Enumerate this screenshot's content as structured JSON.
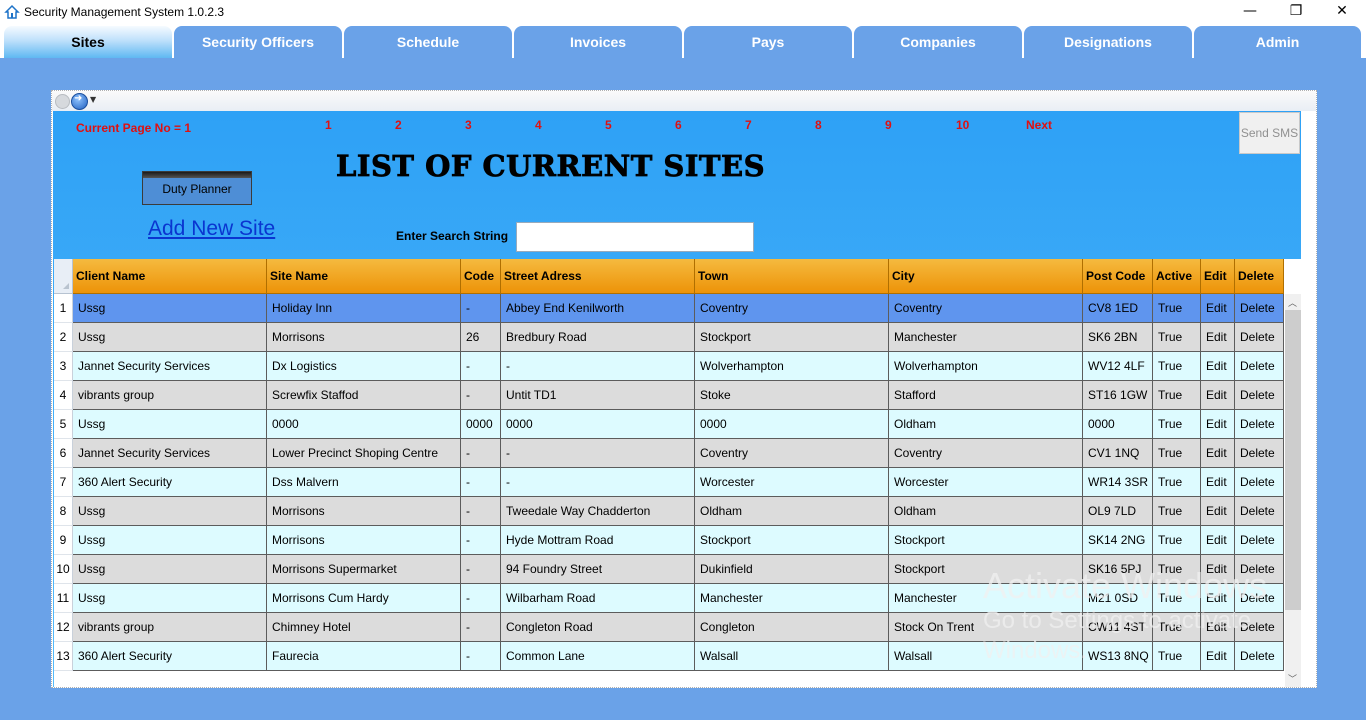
{
  "window": {
    "title": "Security Management System 1.0.2.3",
    "minimize": "—",
    "maximize": "❐",
    "close": "✕"
  },
  "tabs": [
    "Sites",
    "Security Officers",
    "Schedule",
    "Invoices",
    "Pays",
    "Companies",
    "Designations",
    "Admin"
  ],
  "active_tab": "Sites",
  "page": {
    "current_page_label": "Current Page No = 1",
    "pager": [
      "1",
      "2",
      "3",
      "4",
      "5",
      "6",
      "7",
      "8",
      "9",
      "10",
      "Next"
    ],
    "send_sms": "Send SMS",
    "title": "LIST OF CURRENT SITES",
    "duty_planner": "Duty Planner",
    "add_new_site": "Add New Site",
    "search_label": "Enter Search String",
    "search_value": ""
  },
  "grid": {
    "columns": [
      "Client Name",
      "Site Name",
      "Code",
      "Street Adress",
      "Town",
      "City",
      "Post Code",
      "Active",
      "Edit",
      "Delete"
    ],
    "rows": [
      [
        "Ussg",
        "Holiday Inn",
        "-",
        "Abbey End Kenilworth",
        "Coventry",
        "Coventry",
        "CV8 1ED",
        "True",
        "Edit",
        "Delete"
      ],
      [
        "Ussg",
        "Morrisons",
        "26",
        "Bredbury Road",
        "Stockport",
        "Manchester",
        "SK6 2BN",
        "True",
        "Edit",
        "Delete"
      ],
      [
        "Jannet Security Services",
        "Dx Logistics",
        "-",
        "-",
        "Wolverhampton",
        "Wolverhampton",
        "WV12 4LF",
        "True",
        "Edit",
        "Delete"
      ],
      [
        "vibrants group",
        "Screwfix Staffod",
        "-",
        "Untit TD1",
        "Stoke",
        "Stafford",
        "ST16 1GW",
        "True",
        "Edit",
        "Delete"
      ],
      [
        "Ussg",
        "0000",
        "0000",
        "0000",
        "0000",
        "Oldham",
        "0000",
        "True",
        "Edit",
        "Delete"
      ],
      [
        "Jannet Security Services",
        "Lower Precinct Shoping Centre",
        "-",
        "-",
        "Coventry",
        "Coventry",
        "CV1 1NQ",
        "True",
        "Edit",
        "Delete"
      ],
      [
        "360 Alert Security",
        "Dss Malvern",
        "-",
        "-",
        "Worcester",
        "Worcester",
        "WR14 3SR",
        "True",
        "Edit",
        "Delete"
      ],
      [
        "Ussg",
        "Morrisons",
        "-",
        "Tweedale Way Chadderton",
        "Oldham",
        "Oldham",
        "OL9 7LD",
        "True",
        "Edit",
        "Delete"
      ],
      [
        "Ussg",
        "Morrisons",
        "-",
        "Hyde Mottram Road",
        "Stockport",
        "Stockport",
        "SK14 2NG",
        "True",
        "Edit",
        "Delete"
      ],
      [
        "Ussg",
        "Morrisons Supermarket",
        "-",
        "94 Foundry Street",
        "Dukinfield",
        "Stockport",
        "SK16 5PJ",
        "True",
        "Edit",
        "Delete"
      ],
      [
        "Ussg",
        "Morrisons Cum Hardy",
        "-",
        "Wilbarham Road",
        "Manchester",
        "Manchester",
        "M21 0SD",
        "True",
        "Edit",
        "Delete"
      ],
      [
        "vibrants group",
        "Chimney Hotel",
        "-",
        "Congleton Road",
        "Congleton",
        "Stock On Trent",
        "CW11 4ST",
        "True",
        "Edit",
        "Delete"
      ],
      [
        "360 Alert Security",
        "Faurecia",
        "-",
        "Common Lane",
        "Walsall",
        "Walsall",
        "WS13 8NQ",
        "True",
        "Edit",
        "Delete"
      ]
    ]
  },
  "watermark": {
    "line1": "Activate Windows",
    "line2": "Go to Settings to activate",
    "line3": "Windows."
  },
  "colors": {
    "tab_bar": "#6aa2e8",
    "header_orange": "#ed9308",
    "selected_row": "#5f95ee",
    "pager_red": "#e01010"
  },
  "icons": {
    "app": "house-icon",
    "back": "back-arrow-icon",
    "forward": "forward-arrow-icon"
  }
}
